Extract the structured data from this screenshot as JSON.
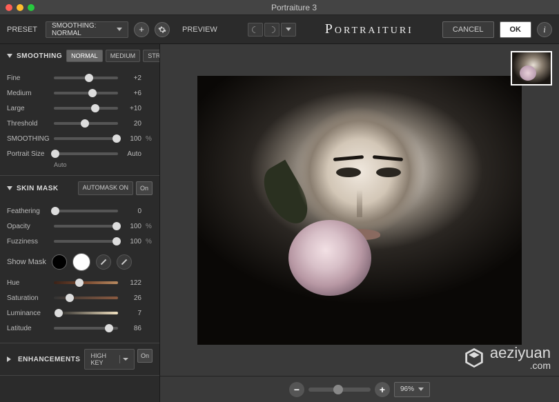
{
  "window": {
    "title": "Portraiture 3"
  },
  "toolbar": {
    "preset_label": "PRESET",
    "preset_value": "SMOOTHING: NORMAL",
    "preview_label": "PREVIEW",
    "brand": "Portraituri",
    "cancel": "CANCEL",
    "ok": "OK"
  },
  "smoothing": {
    "title": "SMOOTHING",
    "modes": [
      "NORMAL",
      "MEDIUM",
      "STRONG"
    ],
    "active_mode": "NORMAL",
    "rows": [
      {
        "label": "Fine",
        "value": "+2",
        "pos": 55
      },
      {
        "label": "Medium",
        "value": "+6",
        "pos": 60
      },
      {
        "label": "Large",
        "value": "+10",
        "pos": 65
      },
      {
        "label": "Threshold",
        "value": "20",
        "pos": 48
      },
      {
        "label": "SMOOTHING",
        "value": "100",
        "unit": "%",
        "pos": 98
      },
      {
        "label": "Portrait Size",
        "value": "Auto",
        "pos": 2,
        "sub": "Auto"
      }
    ]
  },
  "skinmask": {
    "title": "SKIN MASK",
    "automask_label": "AUTOMASK ON",
    "toggle": "On",
    "rows_top": [
      {
        "label": "Feathering",
        "value": "0",
        "pos": 2
      },
      {
        "label": "Opacity",
        "value": "100",
        "unit": "%",
        "pos": 98
      },
      {
        "label": "Fuzziness",
        "value": "100",
        "unit": "%",
        "pos": 98
      }
    ],
    "showmask_label": "Show Mask",
    "rows_bottom": [
      {
        "label": "Hue",
        "value": "122",
        "pos": 40,
        "grad": "hue"
      },
      {
        "label": "Saturation",
        "value": "26",
        "pos": 25,
        "grad": "sat"
      },
      {
        "label": "Luminance",
        "value": "7",
        "pos": 8,
        "grad": "lum"
      },
      {
        "label": "Latitude",
        "value": "86",
        "pos": 86
      }
    ]
  },
  "enhancements": {
    "title": "ENHANCEMENTS",
    "preset": "HIGH KEY",
    "toggle": "On"
  },
  "zoom": {
    "value": "96%"
  },
  "watermark": {
    "text": "aeziyuan",
    "domain": ".com"
  }
}
